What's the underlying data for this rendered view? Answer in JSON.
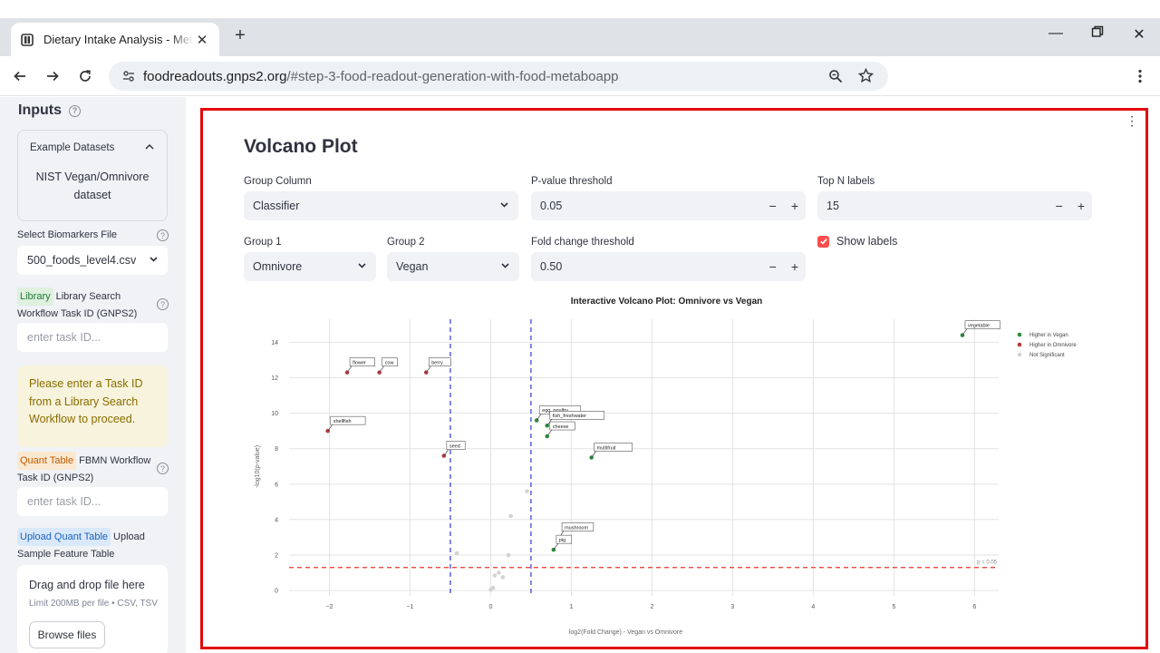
{
  "browser": {
    "tab_title": "Dietary Intake Analysis - Metaboapp",
    "url_domain": "foodreadouts.gnps2.org",
    "url_path": "/#step-3-food-readout-generation-with-food-metaboapp"
  },
  "sidebar": {
    "title": "Inputs",
    "example": {
      "header": "Example Datasets",
      "body_line1": "NIST Vegan/Omnivore",
      "body_line2": "dataset"
    },
    "biomarkers_label": "Select Biomarkers File",
    "biomarkers_value": "500_foods_level4.csv",
    "library_badge": "Library",
    "library_label": "Library Search Workflow Task ID (GNPS2)",
    "library_placeholder": "enter task ID...",
    "warning": "Please enter a Task ID from a Library Search Workflow to proceed.",
    "quant_badge": "Quant Table",
    "quant_label": "FBMN Workflow Task ID (GNPS2)",
    "quant_placeholder": "enter task ID...",
    "upload_badge": "Upload Quant Table",
    "upload_label": "Upload Sample Feature Table",
    "drop_title": "Drag and drop file here",
    "drop_limit": "Limit 200MB per file • CSV, TSV",
    "browse_label": "Browse files"
  },
  "main": {
    "title": "Volcano Plot",
    "group_column_label": "Group Column",
    "group_column_value": "Classifier",
    "pvalue_label": "P-value threshold",
    "pvalue_value": "0.05",
    "topn_label": "Top N labels",
    "topn_value": "15",
    "group1_label": "Group 1",
    "group1_value": "Omnivore",
    "group2_label": "Group 2",
    "group2_value": "Vegan",
    "fold_label": "Fold change threshold",
    "fold_value": "0.50",
    "show_labels": "Show labels"
  },
  "colors": {
    "vegan": "#2e8b3e",
    "omnivore": "#b23a3a",
    "ns": "#d3d3d3",
    "threshold_v": "#2a3bd6",
    "threshold_h": "#e8332f",
    "accent": "#ff4b4b"
  },
  "chart_data": {
    "type": "scatter",
    "title": "Interactive Volcano Plot: Omnivore vs Vegan",
    "xlabel": "log2(Fold Change) - Vegan vs Omnivore",
    "ylabel": "-log10(p-value)",
    "xlim": [
      -2.5,
      6.3
    ],
    "ylim": [
      -0.3,
      15.3
    ],
    "xticks": [
      -2,
      -1,
      0,
      1,
      2,
      3,
      4,
      5,
      6
    ],
    "yticks": [
      0,
      2,
      4,
      6,
      8,
      10,
      12,
      14
    ],
    "thresholds": {
      "fold": 0.5,
      "p_line": 1.3,
      "p_label": "p = 0.05"
    },
    "legend": [
      "Higher in Vegan",
      "Higher in Omnivore",
      "Not Significant"
    ],
    "series": [
      {
        "name": "Higher in Vegan",
        "points": [
          {
            "x": 5.85,
            "y": 14.4,
            "label": "vegetable"
          },
          {
            "x": 0.57,
            "y": 9.6,
            "label": "egg_poultry"
          },
          {
            "x": 0.7,
            "y": 9.3,
            "label": "fish_freshwater"
          },
          {
            "x": 0.7,
            "y": 8.7,
            "label": "cheese"
          },
          {
            "x": 1.25,
            "y": 7.5,
            "label": "multifruit"
          },
          {
            "x": 0.85,
            "y": 3.0,
            "label": "mushroom"
          },
          {
            "x": 0.78,
            "y": 2.3,
            "label": "pig"
          }
        ]
      },
      {
        "name": "Higher in Omnivore",
        "points": [
          {
            "x": -1.78,
            "y": 12.3,
            "label": "flower"
          },
          {
            "x": -1.38,
            "y": 12.3,
            "label": "cow"
          },
          {
            "x": -0.8,
            "y": 12.3,
            "label": "berry"
          },
          {
            "x": -2.02,
            "y": 9.0,
            "label": "shellfish"
          },
          {
            "x": -0.58,
            "y": 7.6,
            "label": "seed"
          }
        ]
      },
      {
        "name": "Not Significant",
        "points": [
          {
            "x": 0.45,
            "y": 5.6
          },
          {
            "x": 0.25,
            "y": 4.2
          },
          {
            "x": -0.42,
            "y": 2.1
          },
          {
            "x": 0.22,
            "y": 2.0
          },
          {
            "x": 0.1,
            "y": 1.0
          },
          {
            "x": 0.05,
            "y": 0.85
          },
          {
            "x": 0.15,
            "y": 0.75
          },
          {
            "x": 0.03,
            "y": 0.15
          },
          {
            "x": 0.0,
            "y": 0.05
          }
        ]
      }
    ]
  }
}
